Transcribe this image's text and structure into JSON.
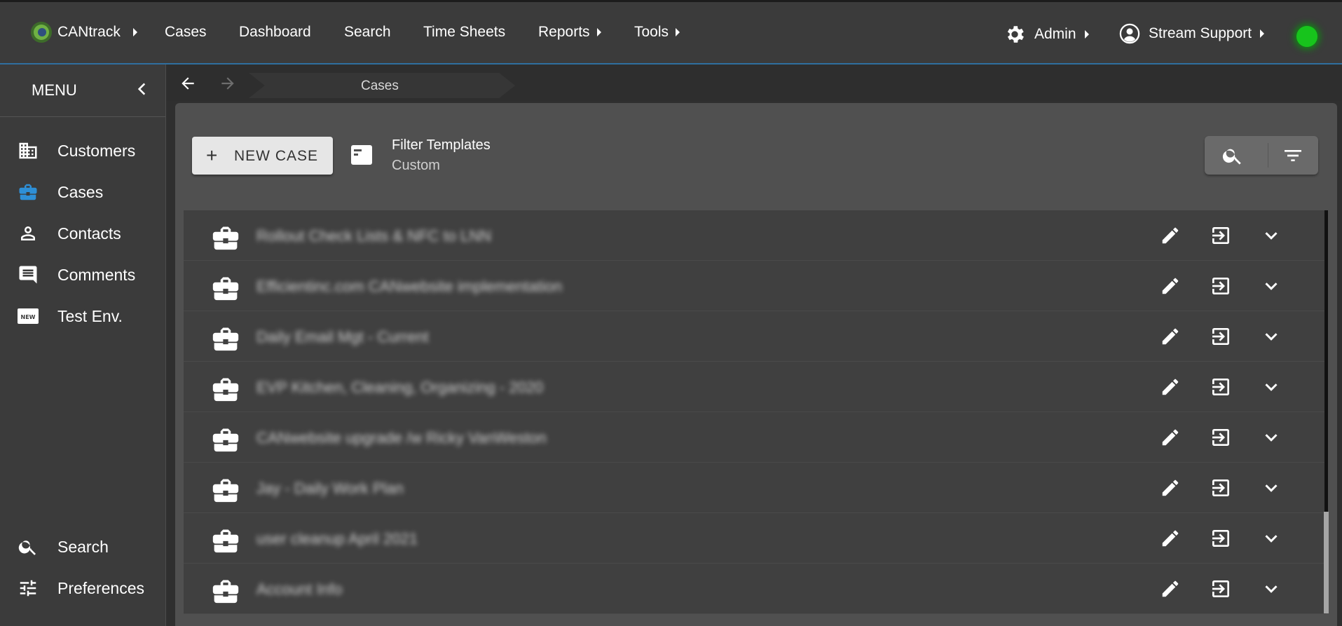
{
  "topbar": {
    "brand": "CANtrack",
    "nav": [
      "Cases",
      "Dashboard",
      "Search",
      "Time Sheets",
      "Reports",
      "Tools"
    ],
    "admin_label": "Admin",
    "user_label": "Stream Support",
    "status_color": "#17c41c"
  },
  "sidebar": {
    "menu_title": "MENU",
    "items": [
      {
        "label": "Customers",
        "icon": "building-icon"
      },
      {
        "label": "Cases",
        "icon": "briefcase-icon",
        "active": true
      },
      {
        "label": "Contacts",
        "icon": "person-icon"
      },
      {
        "label": "Comments",
        "icon": "comment-icon"
      },
      {
        "label": "Test Env.",
        "icon": "new-badge-icon"
      }
    ],
    "bottom_items": [
      {
        "label": "Search",
        "icon": "search-icon"
      },
      {
        "label": "Preferences",
        "icon": "sliders-icon"
      }
    ],
    "accent_color": "#2e8fd6"
  },
  "breadcrumb": {
    "current": "Cases"
  },
  "toolbar": {
    "new_case_label": "NEW CASE",
    "filter_templates_title": "Filter Templates",
    "filter_templates_value": "Custom"
  },
  "cases": [
    {
      "title": "Rollout Check Lists & NFC to LNN"
    },
    {
      "title": "Efficientinc.com CANwebsite implementation"
    },
    {
      "title": "Daily Email Mgt - Current"
    },
    {
      "title": "EVP Kitchen, Cleaning, Organizing - 2020"
    },
    {
      "title": "CANwebsite upgrade /w Ricky VanWeston"
    },
    {
      "title": "Jay - Daily Work Plan"
    },
    {
      "title": "user cleanup April 2021"
    },
    {
      "title": "Account Info"
    }
  ]
}
